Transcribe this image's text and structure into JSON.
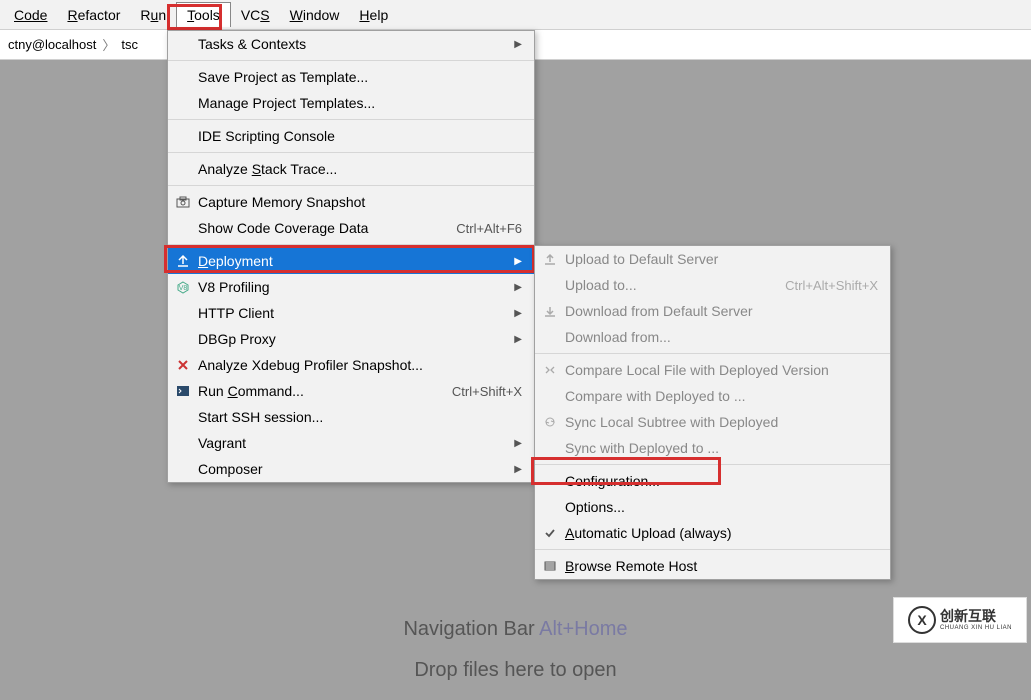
{
  "menubar": {
    "items": [
      {
        "label": "Code",
        "u": 0
      },
      {
        "label": "Refactor",
        "u": 0
      },
      {
        "label": "Run",
        "u": 1
      },
      {
        "label": "Tools",
        "u": 0
      },
      {
        "label": "VCS",
        "u": 2
      },
      {
        "label": "Window",
        "u": 0
      },
      {
        "label": "Help",
        "u": 0
      }
    ]
  },
  "breadcrumb": {
    "root": "ctny@localhost",
    "leaf": "tsc"
  },
  "tools_menu": {
    "items": [
      {
        "label": "Tasks & Contexts",
        "submenu": true
      },
      {
        "sep": true
      },
      {
        "label": "Save Project as Template..."
      },
      {
        "label": "Manage Project Templates..."
      },
      {
        "sep": true
      },
      {
        "label": "IDE Scripting Console"
      },
      {
        "sep": true
      },
      {
        "label": "Analyze Stack Trace..."
      },
      {
        "sep": true
      },
      {
        "label": "Capture Memory Snapshot",
        "icon": "camera"
      },
      {
        "label": "Show Code Coverage Data",
        "shortcut": "Ctrl+Alt+F6"
      },
      {
        "sep": true
      },
      {
        "label": "Deployment",
        "icon": "deploy",
        "submenu": true,
        "selected": true
      },
      {
        "label": "V8 Profiling",
        "icon": "v8",
        "submenu": true
      },
      {
        "label": "HTTP Client",
        "submenu": true
      },
      {
        "label": "DBGp Proxy",
        "submenu": true
      },
      {
        "label": "Analyze Xdebug Profiler Snapshot...",
        "icon": "xdebug"
      },
      {
        "label": "Run Command...",
        "icon": "terminal",
        "shortcut": "Ctrl+Shift+X"
      },
      {
        "label": "Start SSH session..."
      },
      {
        "label": "Vagrant",
        "submenu": true
      },
      {
        "label": "Composer",
        "submenu": true
      }
    ]
  },
  "deploy_menu": {
    "items": [
      {
        "label": "Upload to Default Server",
        "icon": "upload",
        "disabled": true
      },
      {
        "label": "Upload to...",
        "shortcut": "Ctrl+Alt+Shift+X",
        "disabled": true
      },
      {
        "label": "Download from Default Server",
        "icon": "download",
        "disabled": true
      },
      {
        "label": "Download from...",
        "disabled": true
      },
      {
        "sep": true
      },
      {
        "label": "Compare Local File with Deployed Version",
        "icon": "compare",
        "disabled": true
      },
      {
        "label": "Compare with Deployed to ...",
        "disabled": true
      },
      {
        "label": "Sync Local Subtree with Deployed",
        "icon": "sync",
        "disabled": true
      },
      {
        "label": "Sync with Deployed to ...",
        "disabled": true
      },
      {
        "sep": true
      },
      {
        "label": "Configuration..."
      },
      {
        "label": "Options..."
      },
      {
        "label": "Automatic Upload (always)",
        "icon": "check"
      },
      {
        "sep": true
      },
      {
        "label": "Browse Remote Host",
        "icon": "browse"
      }
    ]
  },
  "bg_hints": {
    "line1_a": "Navigation Bar",
    "line1_b": "Alt+Home",
    "line2": "Drop files here to open"
  },
  "watermark": {
    "logo": "X",
    "main": "创新互联",
    "sub": "CHUANG XIN HU LIAN"
  }
}
